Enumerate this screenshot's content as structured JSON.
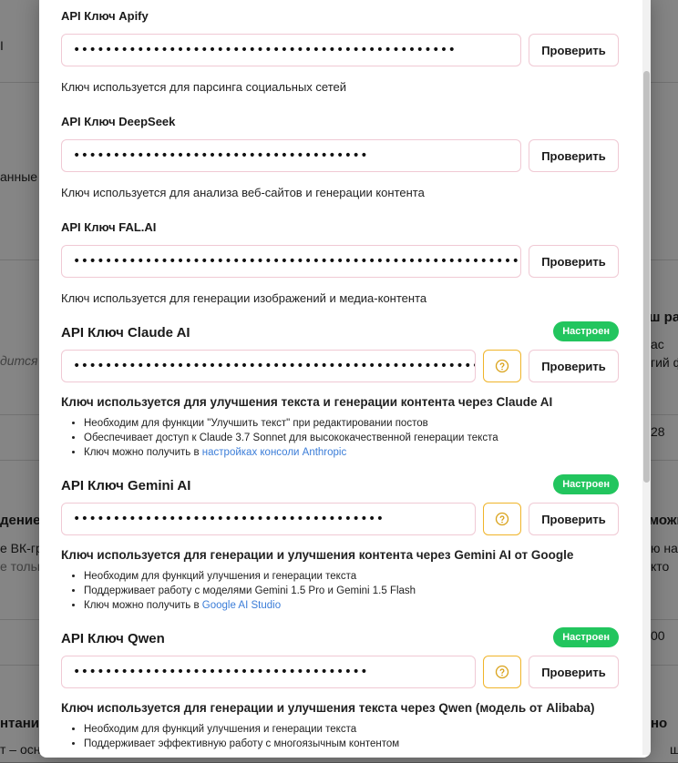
{
  "background": {
    "fragments": [
      "I",
      "анные",
      "дится",
      "ш ра",
      "ас",
      "гий ф",
      "28",
      "дение",
      "е ВК-гр",
      "е тольк",
      "можн",
      "ю на",
      "кто",
      "00",
      "нтания",
      "т – основ",
      "но",
      "щ"
    ]
  },
  "modal": {
    "apify": {
      "label": "API Ключ Apify",
      "value": "••••••••••••••••••••••••••••••••••••••••••••••••",
      "check_label": "Проверить",
      "hint": "Ключ используется для парсинга социальных сетей"
    },
    "deepseek": {
      "label": "API Ключ DeepSeek",
      "value": "•••••••••••••••••••••••••••••••••••••",
      "check_label": "Проверить",
      "hint": "Ключ используется для анализа веб-сайтов и генерации контента"
    },
    "falai": {
      "label": "API Ключ FAL.AI",
      "value": "••••••••••••••••••••••••••••••••••••••••••••••••••••••••••••••••••••••••",
      "check_label": "Проверить",
      "hint": "Ключ используется для генерации изображений и медиа-контента"
    },
    "claude": {
      "label": "API Ключ Claude AI",
      "badge": "Настроен",
      "value": "•••••••••••••••••••••••••••••••••••••••••••••••••••••••••••••••••••••••••••••••••••••••••••••••••••••••••••",
      "check_label": "Проверить",
      "hint": "Ключ используется для улучшения текста и генерации контента через Claude AI",
      "bullets": [
        "Необходим для функции \"Улучшить текст\" при редактировании постов",
        "Обеспечивает доступ к Claude 3.7 Sonnet для высококачественной генерации текста"
      ],
      "get_key_prefix": "Ключ можно получить в ",
      "get_key_link": "настройках консоли Anthropic"
    },
    "gemini": {
      "label": "API Ключ Gemini AI",
      "badge": "Настроен",
      "value": "•••••••••••••••••••••••••••••••••••••••",
      "check_label": "Проверить",
      "hint": "Ключ используется для генерации и улучшения контента через Gemini AI от Google",
      "bullets": [
        "Необходим для функций улучшения и генерации текста",
        "Поддерживает работу с моделями Gemini 1.5 Pro и Gemini 1.5 Flash"
      ],
      "get_key_prefix": "Ключ можно получить в ",
      "get_key_link": "Google AI Studio"
    },
    "qwen": {
      "label": "API Ключ Qwen",
      "badge": "Настроен",
      "value": "•••••••••••••••••••••••••••••••••••••",
      "check_label": "Проверить",
      "hint": "Ключ используется для генерации и улучшения текста через Qwen (модель от Alibaba)",
      "bullets": [
        "Необходим для функций улучшения и генерации текста",
        "Поддерживает эффективную работу с многоязычным контентом"
      ]
    },
    "colors": {
      "badge": "#22c55e",
      "help_border": "#f0b429",
      "input_border": "#f0c9d4",
      "link": "#3b7dd8"
    },
    "help_icon": "question-circle-icon"
  }
}
